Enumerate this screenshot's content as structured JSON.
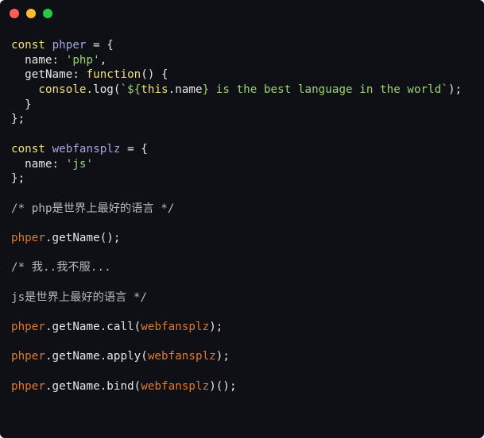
{
  "window": {
    "controls": [
      {
        "name": "close",
        "color": "#ff5f57"
      },
      {
        "name": "minimize",
        "color": "#febc2e"
      },
      {
        "name": "maximize",
        "color": "#28c840"
      }
    ]
  },
  "theme": {
    "background": "#0f1016",
    "keyword": "#f1e07a",
    "variable": "#a3a6df",
    "string": "#9ad46f",
    "comment": "#b8b8b8",
    "object": "#e0792e",
    "plain": "#e6e6e6"
  },
  "code": {
    "lines": [
      [
        [
          "kw",
          "const"
        ],
        [
          "plain",
          " "
        ],
        [
          "var",
          "phper"
        ],
        [
          "plain",
          " = {"
        ]
      ],
      [
        [
          "plain",
          "  name: "
        ],
        [
          "str",
          "'php'"
        ],
        [
          "plain",
          ","
        ]
      ],
      [
        [
          "plain",
          "  getName: "
        ],
        [
          "kw",
          "function"
        ],
        [
          "plain",
          "() {"
        ]
      ],
      [
        [
          "plain",
          "    "
        ],
        [
          "kw",
          "console"
        ],
        [
          "plain",
          ".log("
        ],
        [
          "str",
          "`${"
        ],
        [
          "this",
          "this"
        ],
        [
          "plain",
          ".name"
        ],
        [
          "str",
          "} is the best language in the world`"
        ],
        [
          "plain",
          ");"
        ]
      ],
      [
        [
          "plain",
          "  }"
        ]
      ],
      [
        [
          "plain",
          "};"
        ]
      ],
      [],
      [
        [
          "kw",
          "const"
        ],
        [
          "plain",
          " "
        ],
        [
          "var",
          "webfansplz"
        ],
        [
          "plain",
          " = {"
        ]
      ],
      [
        [
          "plain",
          "  name: "
        ],
        [
          "str",
          "'js'"
        ]
      ],
      [
        [
          "plain",
          "};"
        ]
      ],
      [],
      [
        [
          "comment",
          "/* php是世界上最好的语言 */"
        ]
      ],
      [],
      [
        [
          "obj",
          "phper"
        ],
        [
          "plain",
          ".getName();"
        ]
      ],
      [],
      [
        [
          "comment",
          "/* 我..我不服..."
        ]
      ],
      [],
      [
        [
          "comment",
          "js是世界上最好的语言 */"
        ]
      ],
      [],
      [
        [
          "obj",
          "phper"
        ],
        [
          "plain",
          ".getName.call("
        ],
        [
          "obj",
          "webfansplz"
        ],
        [
          "plain",
          ");"
        ]
      ],
      [],
      [
        [
          "obj",
          "phper"
        ],
        [
          "plain",
          ".getName.apply("
        ],
        [
          "obj",
          "webfansplz"
        ],
        [
          "plain",
          ");"
        ]
      ],
      [],
      [
        [
          "obj",
          "phper"
        ],
        [
          "plain",
          ".getName.bind("
        ],
        [
          "obj",
          "webfansplz"
        ],
        [
          "plain",
          ")();"
        ]
      ]
    ]
  }
}
